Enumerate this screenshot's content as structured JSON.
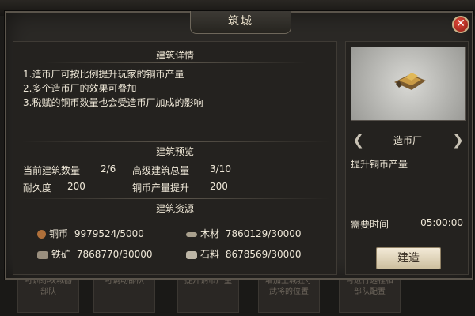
{
  "dialog": {
    "title": "筑城",
    "close_icon": "close-icon"
  },
  "details": {
    "title": "建筑详情",
    "lines": [
      "1.造币厂可按比例提升玩家的铜币产量",
      "2.多个造币厂的效果可叠加",
      "3.税赋的铜币数量也会受造币厂加成的影响"
    ]
  },
  "preview": {
    "title": "建筑预览",
    "current_count_label": "当前建筑数量",
    "current_count_value": "2/6",
    "advanced_total_label": "高级建筑总量",
    "advanced_total_value": "3/10",
    "durability_label": "耐久度",
    "durability_value": "200",
    "copper_boost_label": "铜币产量提升",
    "copper_boost_value": "200"
  },
  "resources": {
    "title": "建筑资源",
    "items": [
      {
        "icon": "copper-coin-icon",
        "name": "铜币",
        "value": "9979524/5000"
      },
      {
        "icon": "wood-icon",
        "name": "木材",
        "value": "7860129/30000"
      },
      {
        "icon": "iron-ore-icon",
        "name": "铁矿",
        "value": "7868770/30000"
      },
      {
        "icon": "stone-icon",
        "name": "石料",
        "value": "8678569/30000"
      }
    ]
  },
  "building": {
    "name": "造币厂",
    "description": "提升铜币产量",
    "time_label": "需要时间",
    "time_value": "05:00:00",
    "build_button": "建造"
  },
  "background": {
    "items": [
      "可训练攻城器部队",
      "可调动部队",
      "提升铜币产量",
      "增加主城驻守武将的位置",
      "可进行远程和部队配置"
    ]
  },
  "colors": {
    "panel": "#24221f",
    "border": "#5a544b",
    "close": "#b82619",
    "button": "#e6dcc4"
  }
}
